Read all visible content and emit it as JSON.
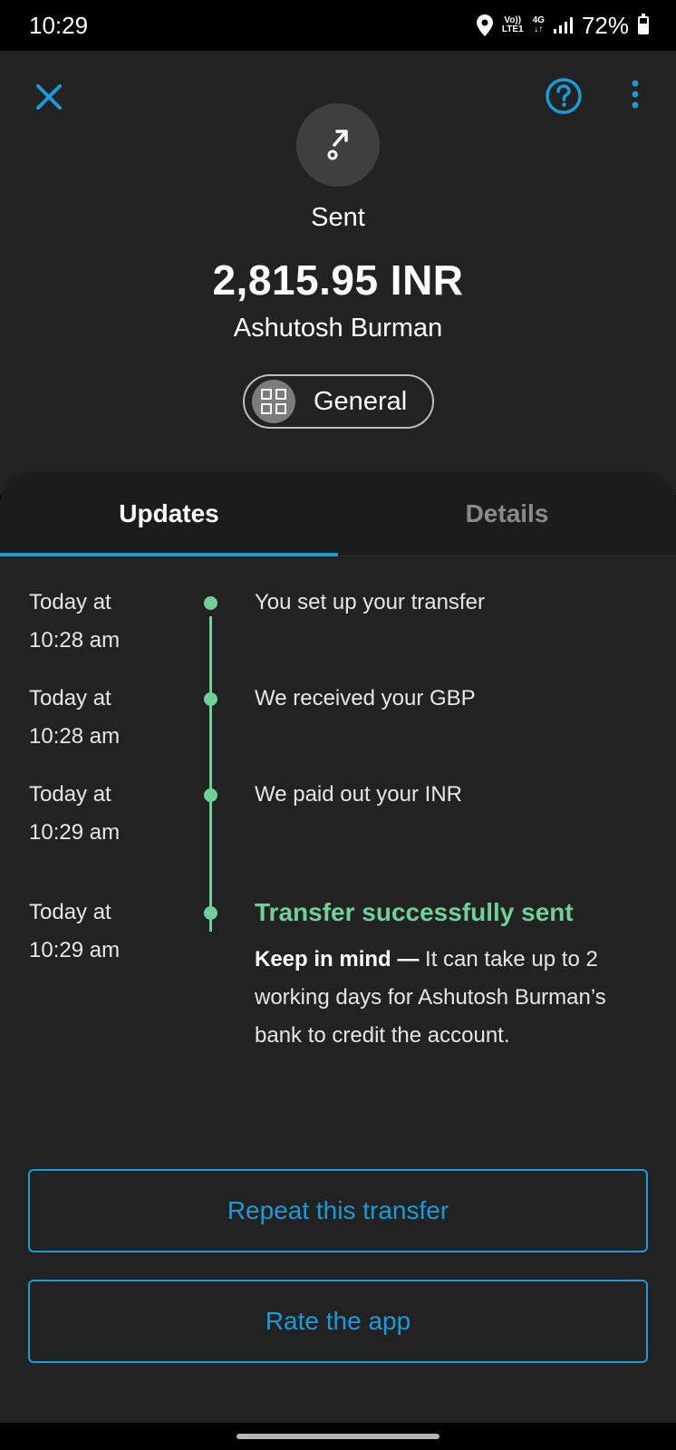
{
  "status_bar": {
    "time": "10:29",
    "network_top": "Vo))",
    "network_bottom": "LTE1",
    "network_type": "4G",
    "battery": "72%"
  },
  "header": {
    "status_label": "Sent",
    "amount": "2,815.95 INR",
    "recipient": "Ashutosh Burman",
    "category": "General"
  },
  "tabs": [
    {
      "label": "Updates",
      "active": true
    },
    {
      "label": "Details",
      "active": false
    }
  ],
  "timeline": [
    {
      "date": "Today at",
      "time": "10:28 am",
      "event": "You set up your transfer"
    },
    {
      "date": "Today at",
      "time": "10:28 am",
      "event": "We received your GBP"
    },
    {
      "date": "Today at",
      "time": "10:29 am",
      "event": "We paid out your INR"
    },
    {
      "date": "Today at",
      "time": "10:29 am",
      "event": "Transfer successfully sent"
    }
  ],
  "note": {
    "bold": "Keep in mind —",
    "text": " It can take up to 2 working days for Ashutosh Burman’s bank to credit the account."
  },
  "actions": {
    "repeat_label": "Repeat this transfer",
    "rate_label": "Rate the app"
  },
  "colors": {
    "accent": "#1a9bd7",
    "success": "#6fd197",
    "background": "#222222"
  }
}
